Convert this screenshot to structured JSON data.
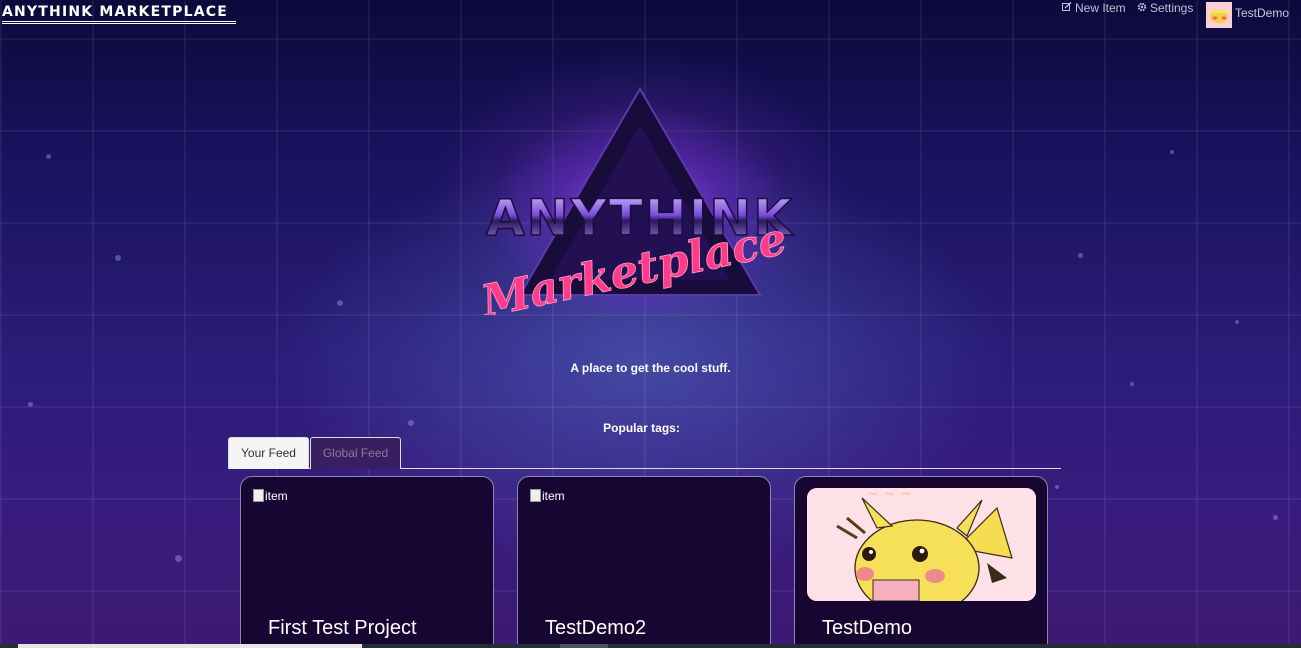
{
  "brand": {
    "name": "ANYTHINK MARKETPLACE"
  },
  "nav": {
    "new_item_label": "New Item",
    "settings_label": "Settings",
    "user_name": "TestDemo"
  },
  "hero": {
    "logo_line1": "ANYTHINK",
    "logo_line2": "Marketplace",
    "tagline": "A place to get the cool stuff.",
    "popular_tags_label": "Popular tags:"
  },
  "tabs": [
    {
      "label": "Your Feed",
      "active": true
    },
    {
      "label": "Global Feed",
      "active": false
    }
  ],
  "items": [
    {
      "image_alt": "item",
      "title": "First Test Project"
    },
    {
      "image_alt": "item",
      "title": "TestDemo2"
    },
    {
      "image_alt": "",
      "title": "TestDemo",
      "image": "pikachu-illustration"
    }
  ],
  "colors": {
    "card_bg": "#170632",
    "card_border": "#8e84b8",
    "accent_pink": "#ff3c8a",
    "accent_purple": "#7a3cff"
  }
}
